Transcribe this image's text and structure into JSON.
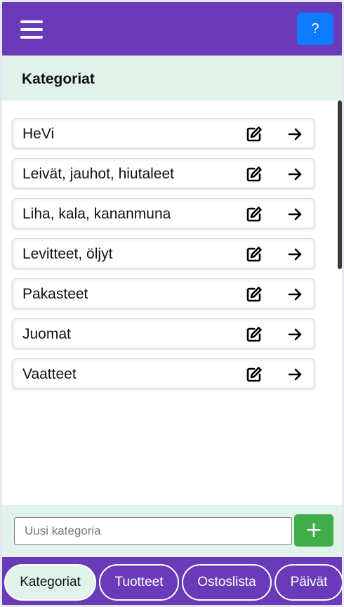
{
  "topbar": {
    "menu_icon": "hamburger-menu-icon",
    "help_label": "?",
    "background": "#6a3bb8",
    "help_color": "#0d7bff"
  },
  "header": {
    "title": "Kategoriat"
  },
  "categories": [
    {
      "label": "HeVi"
    },
    {
      "label": "Leivät, jauhot, hiutaleet"
    },
    {
      "label": "Liha, kala, kananmuna"
    },
    {
      "label": "Levitteet, öljyt"
    },
    {
      "label": "Pakasteet"
    },
    {
      "label": "Juomat"
    },
    {
      "label": "Vaatteet"
    }
  ],
  "row_icons": {
    "edit": "edit-icon",
    "open": "arrow-right-icon"
  },
  "new_category": {
    "placeholder": "Uusi kategoria",
    "value": "",
    "add_label": "+",
    "add_color": "#3fae4a"
  },
  "nav": {
    "tabs": [
      {
        "label": "Kategoriat",
        "active": true
      },
      {
        "label": "Tuotteet",
        "active": false
      },
      {
        "label": "Ostoslista",
        "active": false
      },
      {
        "label": "Päivät",
        "active": false
      }
    ]
  }
}
